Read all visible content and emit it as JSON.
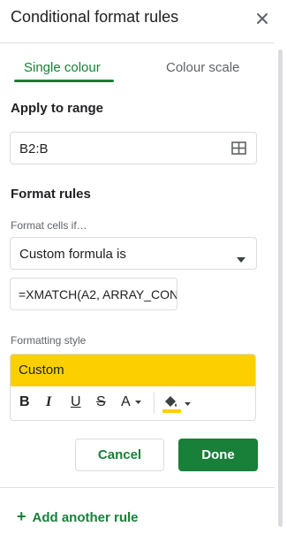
{
  "panel": {
    "title": "Conditional format rules",
    "tabs": [
      {
        "label": "Single colour",
        "active": true
      },
      {
        "label": "Colour scale",
        "active": false
      }
    ]
  },
  "range": {
    "heading": "Apply to range",
    "value": "B2:B"
  },
  "format_rules": {
    "heading": "Format rules",
    "condition_label": "Format cells if…",
    "condition_value": "Custom formula is",
    "formula_value": "=XMATCH(A2, ARRAY_CON"
  },
  "formatting_style": {
    "label": "Formatting style",
    "preset_name": "Custom",
    "preview_color": "#fcd000",
    "toolbar": {
      "bold": "B",
      "italic": "I",
      "underline": "U",
      "strikethrough": "S",
      "text_color": "A"
    }
  },
  "buttons": {
    "cancel": "Cancel",
    "done": "Done"
  },
  "add_rule": {
    "icon": "+",
    "label": "Add another rule"
  },
  "colors": {
    "accent": "#188038",
    "fill": "#fcd000"
  }
}
